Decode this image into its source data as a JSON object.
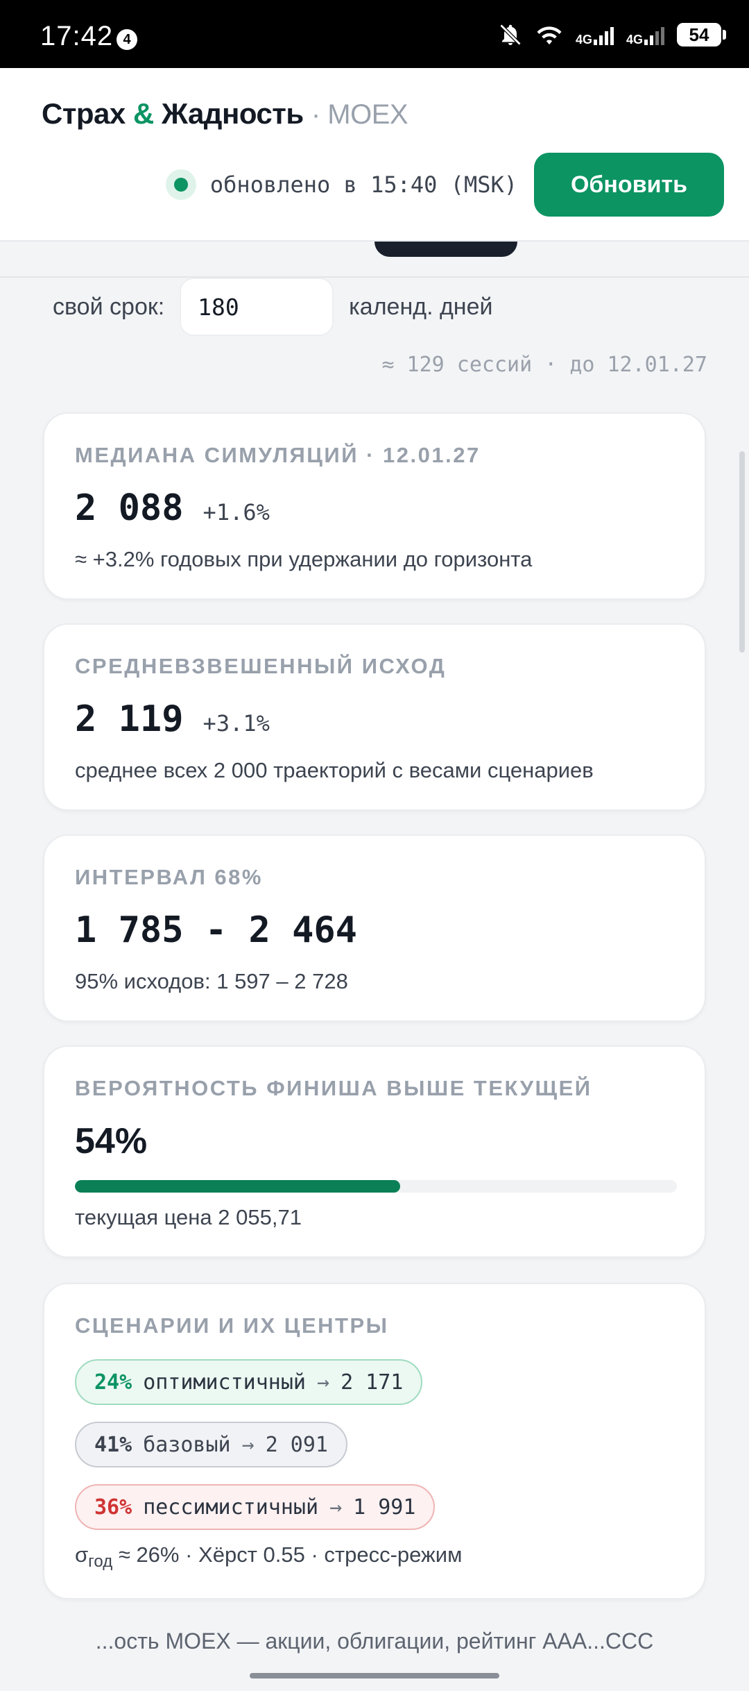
{
  "status_bar": {
    "time": "17:42",
    "notification_badge": "4",
    "network_1": "4G",
    "network_2": "4G",
    "battery": "54",
    "icons": [
      "bell-off-icon",
      "wifi-icon",
      "signal-icon",
      "signal-icon",
      "battery-icon"
    ]
  },
  "header": {
    "brand_part1": "Страх",
    "brand_amp": "&",
    "brand_part2": "Жадность",
    "brand_sub": "· MOEX",
    "updated_text": "обновлено в 15:40 (MSK)",
    "refresh_label": "Обновить"
  },
  "term": {
    "label": "свой срок:",
    "value": "180",
    "unit": "календ. дней",
    "sessions_note": "≈ 129 сессий · до 12.01.27"
  },
  "cards": {
    "median": {
      "title": "МЕДИАНА СИМУЛЯЦИЙ · 12.01.27",
      "value": "2 088",
      "delta": "+1.6%",
      "note": "≈ +3.2% годовых при удержании до горизонта"
    },
    "weighted": {
      "title": "СРЕДНЕВЗВЕШЕННЫЙ ИСХОД",
      "value": "2 119",
      "delta": "+3.1%",
      "note": "среднее всех 2 000 траекторий с весами сценариев"
    },
    "interval": {
      "title": "ИНТЕРВАЛ 68%",
      "value": "1 785 - 2 464",
      "note": "95% исходов: 1 597 – 2 728"
    },
    "probability": {
      "title": "ВЕРОЯТНОСТЬ ФИНИША ВЫШЕ ТЕКУЩЕЙ",
      "value": "54%",
      "progress": 0.54,
      "note": "текущая цена 2 055,71"
    },
    "scenarios": {
      "title": "СЦЕНАРИИ И ИХ ЦЕНТРЫ",
      "items": [
        {
          "pct": "24%",
          "name": "оптимистичный",
          "arrow": "→",
          "center": "2 171"
        },
        {
          "pct": "41%",
          "name": "базовый",
          "arrow": "→",
          "center": "2 091"
        },
        {
          "pct": "36%",
          "name": "пессимистичный",
          "arrow": "→",
          "center": "1 991"
        }
      ],
      "sigma_symbol": "σ",
      "sigma_sub": "год",
      "sigma_rest": " ≈ 26% · Хёрст 0.55 · стресс-режим"
    }
  },
  "footer": {
    "text": "...ость MOEX — акции, облигации, рейтинг AAA...CCC"
  },
  "colors": {
    "accent": "#0c9463",
    "progress": "#0b7f56",
    "negative": "#d03434"
  }
}
